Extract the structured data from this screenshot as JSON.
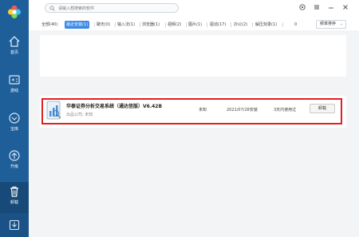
{
  "app": {
    "search_placeholder": "请输入想搜索的软件"
  },
  "sidebar": {
    "items": [
      {
        "label": "首页",
        "icon": "home-icon"
      },
      {
        "label": "游戏",
        "icon": "gamepad-icon"
      },
      {
        "label": "宝库",
        "icon": "treasure-icon"
      },
      {
        "label": "升级",
        "icon": "upgrade-icon"
      },
      {
        "label": "卸载",
        "icon": "trash-icon",
        "active": true
      }
    ]
  },
  "tabs": [
    {
      "label": "全部(40)"
    },
    {
      "label": "最近安装(1)",
      "active": true
    },
    {
      "label": "聊天(0)"
    },
    {
      "label": "输入法(1)"
    },
    {
      "label": "浏览器(1)"
    },
    {
      "label": "视频(2)"
    },
    {
      "label": "图片(1)"
    },
    {
      "label": "驱动(17)"
    },
    {
      "label": "办公(2)"
    },
    {
      "label": "解压刻录(1)"
    },
    {
      "label": "0"
    }
  ],
  "sort": {
    "label": "频率排序"
  },
  "installed": [
    {
      "name": "华泰证券分析交易系统（通达信版）V6.42B",
      "publisher_label": "出品公司:",
      "publisher": "未知",
      "size": "未知",
      "install_date": "2021/07/28安装",
      "last_used": "3天内使用过",
      "action": "卸载"
    }
  ],
  "colors": {
    "sidebar": "#1f5f99",
    "accent": "#3d8ae6",
    "highlight": "#e02020"
  }
}
